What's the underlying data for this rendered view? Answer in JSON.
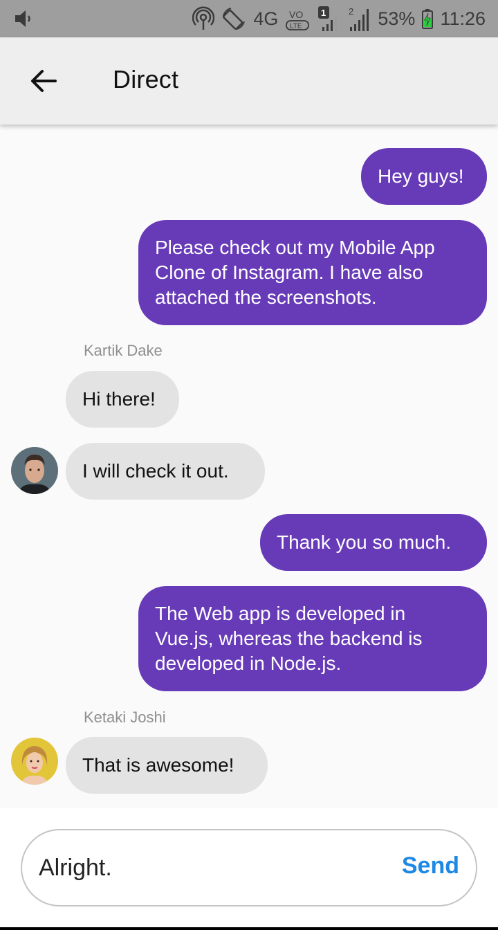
{
  "status_bar": {
    "network": "4G",
    "volte": "VoLTE",
    "sim1": "1",
    "sim2": "2",
    "battery": "53%",
    "time": "11:26"
  },
  "header": {
    "title": "Direct",
    "back_icon": "arrow-left-icon"
  },
  "messages": [
    {
      "direction": "out",
      "text": "Hey guys!"
    },
    {
      "direction": "out",
      "lines": [
        "Please check out my Mobile App",
        "Clone of Instagram. I have also",
        "attached the screenshots."
      ]
    },
    {
      "direction": "in",
      "sender": "Kartik Dake",
      "text": "Hi there!"
    },
    {
      "direction": "in",
      "text": "I will check it out."
    },
    {
      "direction": "out",
      "text": "Thank you so much."
    },
    {
      "direction": "out",
      "lines": [
        "The Web app is developed in",
        "Vue.js, whereas the backend is",
        "developed in Node.js."
      ]
    },
    {
      "direction": "in",
      "sender": "Ketaki Joshi",
      "text": "That is awesome!"
    }
  ],
  "composer": {
    "value": "Alright.",
    "send_label": "Send"
  },
  "colors": {
    "outgoing_bubble": "#673ab7",
    "incoming_bubble": "#e3e3e3",
    "send_accent": "#1e88e5",
    "app_bar": "#eeeeee",
    "status_bar": "#9e9e9e"
  }
}
